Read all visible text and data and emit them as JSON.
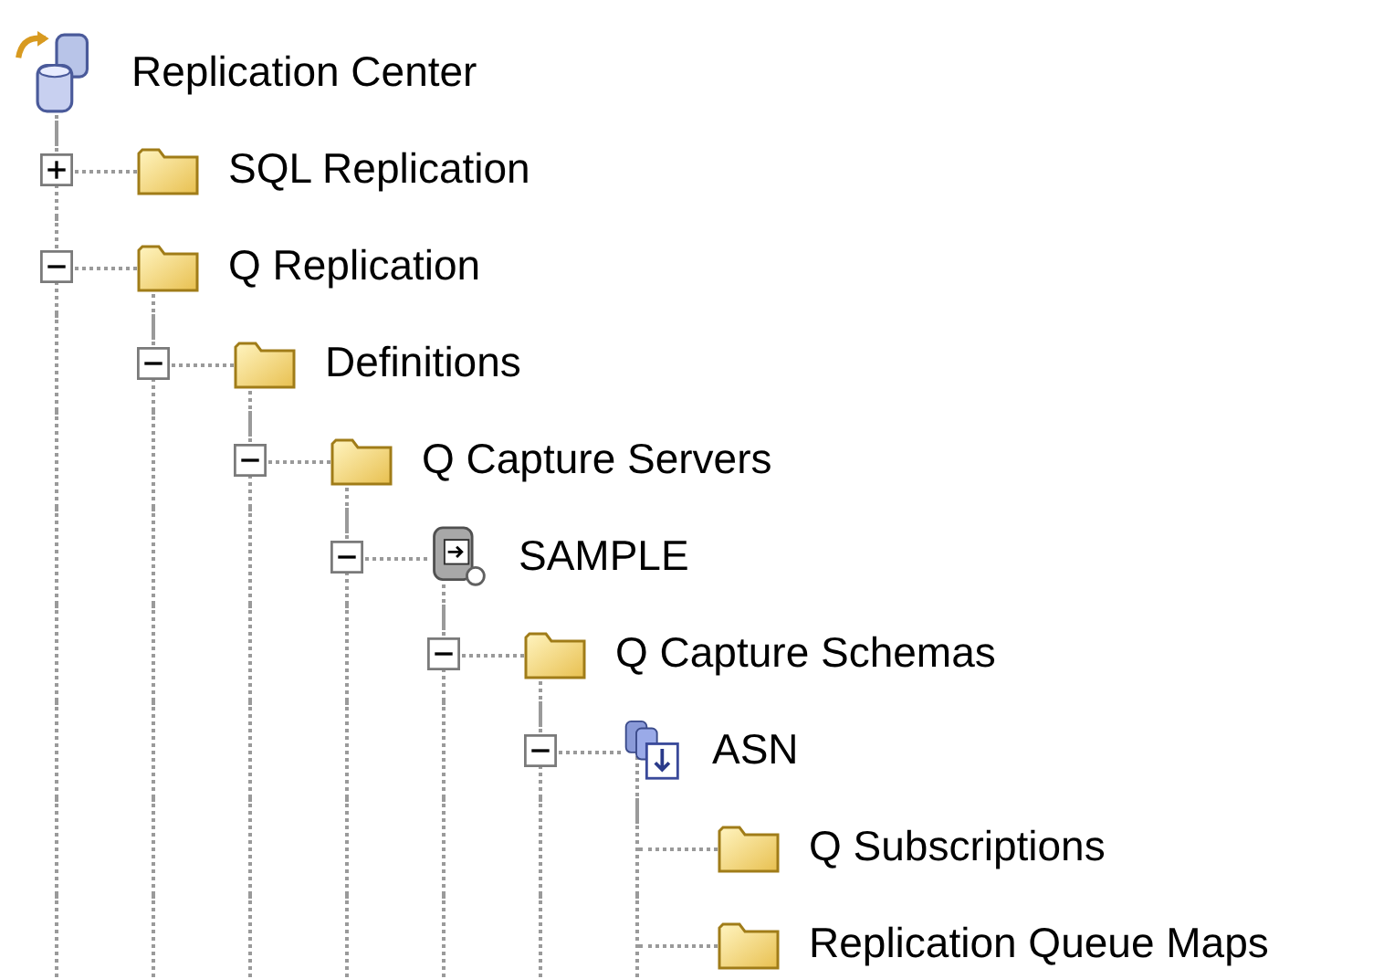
{
  "tree": {
    "label": "Replication Center",
    "kind": "root",
    "children": [
      {
        "label": "SQL Replication",
        "kind": "folder",
        "expanded": false
      },
      {
        "label": "Q Replication",
        "kind": "folder",
        "expanded": true,
        "children": [
          {
            "label": "Definitions",
            "kind": "folder",
            "expanded": true,
            "children": [
              {
                "label": "Q Capture Servers",
                "kind": "folder",
                "expanded": true,
                "children": [
                  {
                    "label": "SAMPLE",
                    "kind": "server",
                    "expanded": true,
                    "children": [
                      {
                        "label": "Q Capture Schemas",
                        "kind": "folder",
                        "expanded": true,
                        "children": [
                          {
                            "label": "ASN",
                            "kind": "schema",
                            "expanded": true,
                            "children": [
                              {
                                "label": "Q Subscriptions",
                                "kind": "folder"
                              },
                              {
                                "label": "Replication Queue Maps",
                                "kind": "folder"
                              }
                            ]
                          }
                        ]
                      }
                    ]
                  }
                ]
              }
            ]
          }
        ]
      }
    ]
  }
}
